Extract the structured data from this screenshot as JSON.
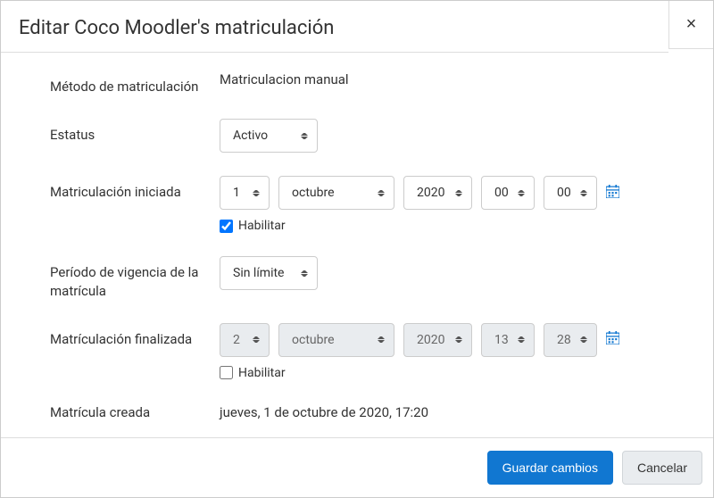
{
  "modal": {
    "title": "Editar Coco Moodler's matriculación",
    "close_label": "×"
  },
  "form": {
    "method_label": "Método de matriculación",
    "method_value": "Matriculacion manual",
    "status_label": "Estatus",
    "status_value": "Activo",
    "start_label": "Matriculación iniciada",
    "start_date": {
      "day": "1",
      "month": "octubre",
      "year": "2020",
      "hour": "00",
      "minute": "00",
      "enabled": true,
      "enable_label": "Habilitar"
    },
    "duration_label": "Período de vigencia de la matrícula",
    "duration_value": "Sin límite",
    "end_label": "Matrículación finalizada",
    "end_date": {
      "day": "2",
      "month": "octubre",
      "year": "2020",
      "hour": "13",
      "minute": "28",
      "enabled": false,
      "enable_label": "Habilitar"
    },
    "created_label": "Matrícula creada",
    "created_value": "jueves, 1 de octubre de 2020, 17:20"
  },
  "footer": {
    "save": "Guardar cambios",
    "cancel": "Cancelar"
  },
  "colors": {
    "primary": "#1177d1"
  }
}
